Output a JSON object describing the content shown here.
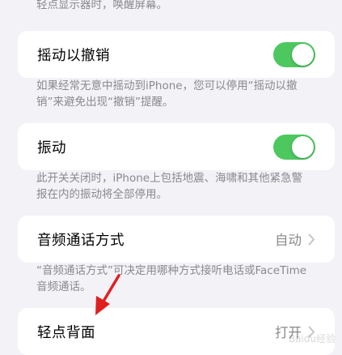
{
  "sections": {
    "top_footer": "轻点显示器时，唤醒屏幕。",
    "shake": {
      "label": "摇动以撤销",
      "toggle_on": true,
      "footer": "如果经常无意中摇动到iPhone，您可以停用“摇动以撤销”来避免出现“撤销”提醒。"
    },
    "vibration": {
      "label": "振动",
      "toggle_on": true,
      "footer": "此开关关闭时，iPhone上包括地震、海啸和其他紧急警报在内的振动将全部停用。"
    },
    "call_audio": {
      "label": "音频通话方式",
      "value": "自动",
      "footer": "“音频通话方式”可决定用哪种方式接听电话或FaceTime音频通话。"
    },
    "back_tap": {
      "label": "轻点背面",
      "value": "打开"
    }
  },
  "colors": {
    "background": "#f2f2f7",
    "toggle_on": "#4cc85f",
    "annotation_arrow": "#e02020",
    "secondary_text": "#8a8a8e"
  },
  "icons": [
    "chevron-right-icon",
    "annotation-arrow"
  ],
  "watermark": "Baidu经验"
}
